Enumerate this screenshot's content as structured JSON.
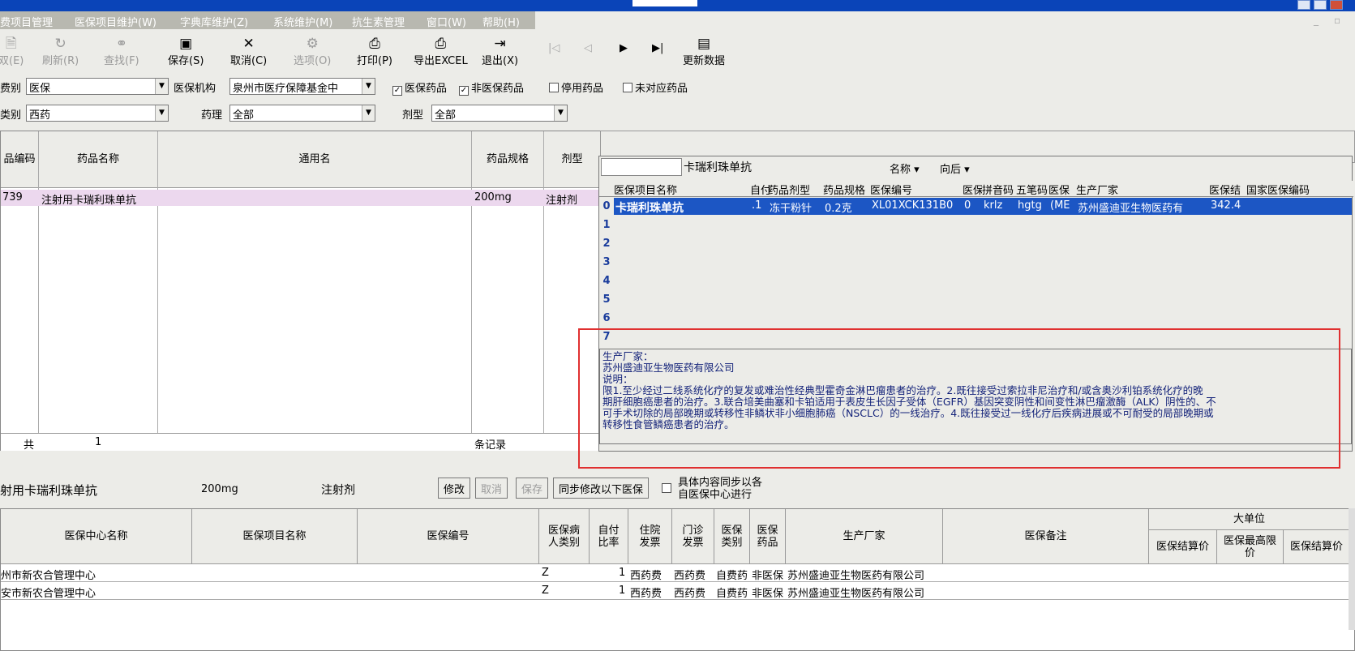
{
  "menu": {
    "items": [
      "费项目管理",
      "医保项目维护(W)",
      "字典库维护(Z)",
      "系统维护(M)",
      "抗生素管理",
      "窗口(W)",
      "帮助(H)"
    ]
  },
  "toolbar": {
    "buttons": [
      {
        "label": "双(E)",
        "icon": "doc-icon"
      },
      {
        "label": "刷新(R)",
        "icon": "refresh-icon"
      },
      {
        "label": "查找(F)",
        "icon": "binoculars-icon"
      },
      {
        "label": "保存(S)",
        "icon": "save-icon"
      },
      {
        "label": "取消(C)",
        "icon": "close-icon"
      },
      {
        "label": "选项(O)",
        "icon": "options-icon"
      },
      {
        "label": "打印(P)",
        "icon": "print-icon"
      },
      {
        "label": "导出EXCEL",
        "icon": "export-icon"
      },
      {
        "label": "退出(X)",
        "icon": "exit-icon"
      },
      {
        "label": "更新数据",
        "icon": "update-icon"
      }
    ],
    "nav": [
      "|◁",
      "◁",
      "▶",
      "▶|"
    ]
  },
  "filters": {
    "fee_label": "费别",
    "fee_value": "医保",
    "org_label": "医保机构",
    "org_value": "泉州市医疗保障基金中",
    "cb1": "医保药品",
    "cb2": "非医保药品",
    "cb3": "停用药品",
    "cb4": "未对应药品",
    "cat_label": "类别",
    "cat_value": "西药",
    "pharm_label": "药理",
    "pharm_value": "全部",
    "form_label": "剂型",
    "form_value": "全部"
  },
  "grid1": {
    "headers": [
      "品编码",
      "药品名称",
      "通用名",
      "药品规格",
      "剂型"
    ],
    "row": {
      "code": "739",
      "name": "注射用卡瑞利珠单抗",
      "generic": "",
      "spec": "200mg",
      "form": "注射剂"
    },
    "sum": {
      "label": "共",
      "count": "1",
      "suffix": "条记录"
    }
  },
  "popup": {
    "search_value": "",
    "title": "卡瑞利珠单抗",
    "mode": "名称 ▾",
    "direction": "向后 ▾",
    "headers": [
      "医保项目名称",
      "自付",
      "药品剂型",
      "药品规格",
      "医保编号",
      "医保",
      "拼音码",
      "五笔码",
      "医保",
      "生产厂家",
      "医保结",
      "国家医保编码"
    ],
    "selected_row": [
      "卡瑞利珠单抗",
      ".1",
      "冻干粉针",
      "0.2克",
      "XL01XCK131B0",
      "0",
      "krlz",
      "hgtg",
      "(ME",
      "苏州盛迪亚生物医药有",
      "342.4",
      ""
    ],
    "row_numbers": [
      "0",
      "1",
      "2",
      "3",
      "4",
      "5",
      "6",
      "7"
    ],
    "desc_lines": [
      "生产厂家：",
      "苏州盛迪亚生物医药有限公司",
      "说明：",
      "限1.至少经过二线系统化疗的复发或难治性经典型霍奇金淋巴瘤患者的治疗。2.既往接受过索拉非尼治疗和/或含奥沙利铂系统化疗的晚",
      "期肝细胞癌患者的治疗。3.联合培美曲塞和卡铂适用于表皮生长因子受体（EGFR）基因突变阴性和间变性淋巴瘤激酶（ALK）阴性的、不",
      "可手术切除的局部晚期或转移性非鳞状非小细胞肺癌（NSCLC）的一线治疗。4.既往接受过一线化疗后疾病进展或不可耐受的局部晚期或",
      "转移性食管鳞癌患者的治疗。"
    ]
  },
  "lower": {
    "name": "射用卡瑞利珠单抗",
    "spec": "200mg",
    "form": "注射剂",
    "btn_edit": "修改",
    "btn_cancel": "取消",
    "btn_save": "保存",
    "btn_sync": "同步修改以下医保",
    "sync_note1": "具体内容同步以各",
    "sync_note2": "自医保中心进行"
  },
  "grid2": {
    "headers": [
      "医保中心名称",
      "医保项目名称",
      "医保编号",
      "医保病人类别",
      "自付比率",
      "住院发票",
      "门诊发票",
      "医保类别",
      "医保药品",
      "生产厂家",
      "医保备注",
      "医保结算价",
      "医保最高限价",
      "医保结算价"
    ],
    "group_header": "大单位",
    "rows": [
      {
        "center": "州市新农合管理中心",
        "item": "",
        "code": "",
        "ptype": "Z",
        "ratio": "1",
        "inv_in": "西药费",
        "inv_out": "西药费",
        "cls": "自费药",
        "drug": "非医保",
        "maker": "苏州盛迪亚生物医药有限公司"
      },
      {
        "center": "安市新农合管理中心",
        "item": "",
        "code": "",
        "ptype": "Z",
        "ratio": "1",
        "inv_in": "西药费",
        "inv_out": "西药费",
        "cls": "自费药",
        "drug": "非医保",
        "maker": "苏州盛迪亚生物医药有限公司"
      }
    ]
  }
}
